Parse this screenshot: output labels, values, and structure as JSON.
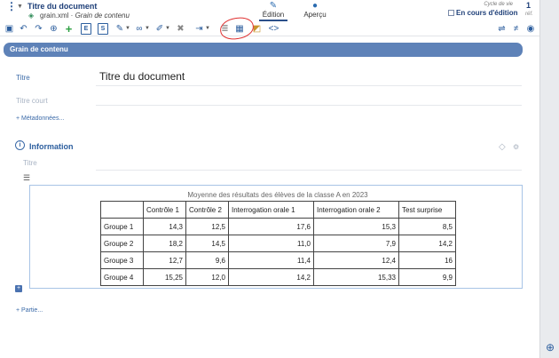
{
  "header": {
    "doc_title": "Titre du document",
    "doc_file": "grain.xml",
    "doc_type": "Grain de contenu",
    "tabs": [
      {
        "label": "Édition",
        "icon": "pen-icon",
        "active": true
      },
      {
        "label": "Aperçu",
        "icon": "chat-icon",
        "active": false
      }
    ],
    "cycle_label": "Cycle de vie",
    "cycle_value": "En cours d'édition",
    "ref_count": "1",
    "ref_label": "réf."
  },
  "toolbar": {
    "bold_e": "E",
    "underline_s": "S"
  },
  "section": {
    "title": "Grain de contenu"
  },
  "form": {
    "titre_label": "Titre",
    "titre_value": "Titre du document",
    "titre_court_label": "Titre court",
    "metadata_link": "+ Métadonnées...",
    "info_label": "Information",
    "info_titre_label": "Titre",
    "partie_link": "+ Partie..."
  },
  "table": {
    "caption": "Moyenne des résultats des élèves de la classe A en 2023",
    "headers": [
      "",
      "Contrôle 1",
      "Contrôle 2",
      "Interrogation orale 1",
      "Interrogation orale 2",
      "Test surprise"
    ],
    "rows": [
      [
        "Groupe 1",
        "14,3",
        "12,5",
        "17,6",
        "15,3",
        "8,5"
      ],
      [
        "Groupe 2",
        "18,2",
        "14,5",
        "11,0",
        "7,9",
        "14,2"
      ],
      [
        "Groupe 3",
        "12,7",
        "9,6",
        "11,4",
        "12,4",
        "16"
      ],
      [
        "Groupe 4",
        "15,25",
        "12,0",
        "14,2",
        "15,33",
        "9,9"
      ]
    ]
  },
  "colors": {
    "accent": "#5e82b8",
    "title": "#1e3f78",
    "highlight": "#e03030"
  }
}
